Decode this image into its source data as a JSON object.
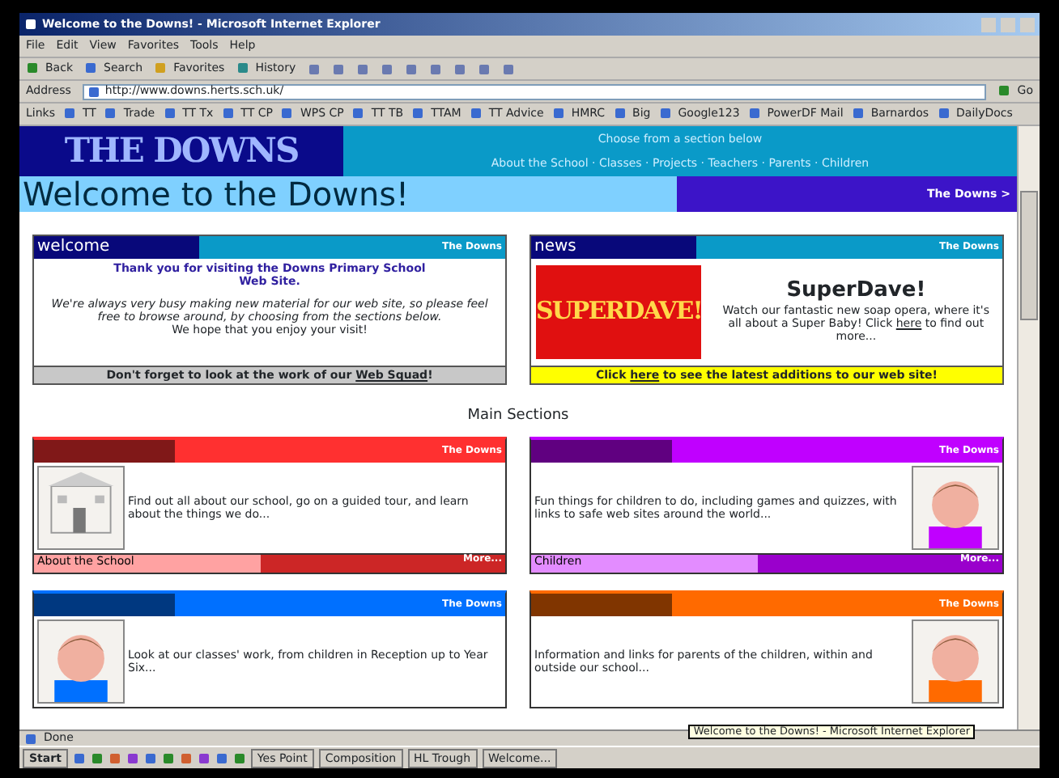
{
  "window": {
    "title": "Welcome to the Downs! - Microsoft Internet Explorer"
  },
  "menu": [
    "File",
    "Edit",
    "View",
    "Favorites",
    "Tools",
    "Help"
  ],
  "toolbar": [
    "Back",
    "Search",
    "Favorites",
    "History"
  ],
  "address": {
    "label": "Address",
    "value": "http://www.downs.herts.sch.uk/",
    "go": "Go"
  },
  "links": {
    "label": "Links",
    "items": [
      "TT",
      "Trade",
      "TT Tx",
      "TT CP",
      "WPS CP",
      "TT TB",
      "TTAM",
      "TT Advice",
      "HMRC",
      "Big",
      "Google123",
      "PowerDF Mail",
      "Barnardos",
      "DailyDocs"
    ]
  },
  "site": {
    "logo": "THE DOWNS",
    "prompt": "Choose from a section below",
    "nav": "About the School · Classes · Projects · Teachers · Parents · Children",
    "heading": "Welcome to the Downs!",
    "crumb": "The Downs >",
    "welcome": {
      "title": "welcome",
      "tag": "The Downs",
      "intro": "Thank you for visiting the Downs Primary School Web Site.",
      "body": "We're always very busy making new material for our web site, so please feel free to browse around, by choosing from the sections below.",
      "outro": "We hope that you enjoy your visit!",
      "footer": "Don't forget to look at the work of our ",
      "footer_link": "Web Squad",
      "footer_end": "!"
    },
    "news": {
      "title": "news",
      "tag": "The Downs",
      "banner": "SUPERDAVE!",
      "heading": "SuperDave!",
      "body": "Watch our fantastic new soap opera, where it's all about a Super Baby! ",
      "body_link": "here",
      "body_pre": "Click ",
      "body_end": " to find out more...",
      "footer_pre": "Click ",
      "footer_link": "here",
      "footer_end": " to see the latest additions to our web site!"
    },
    "sections_title": "Main Sections",
    "sections": [
      {
        "color": "#ff3030",
        "tag": "The Downs",
        "text": "Find out all about our school, go on a guided tour, and learn about the things we do...",
        "label": "About the School",
        "more": "More...",
        "kind": "image-left"
      },
      {
        "color": "#c000ff",
        "tag": "The Downs",
        "text": "Fun things for children to do, including games and quizzes, with links to safe web sites around the world...",
        "label": "Children",
        "more": "More...",
        "kind": "image-right"
      },
      {
        "color": "#0070ff",
        "tag": "The Downs",
        "text": "Look at our classes' work, from children in Reception up to Year Six...",
        "kind": "image-left"
      },
      {
        "color": "#ff6a00",
        "tag": "The Downs",
        "text": "Information and links for parents of the children, within and outside our school...",
        "kind": "image-right"
      }
    ]
  },
  "status": "Done",
  "taskbar": {
    "start": "Start",
    "tasks": [
      "Yes Point",
      "Composition",
      "HL Trough",
      "Welcome..."
    ],
    "tooltip": "Welcome to the Downs! - Microsoft Internet Explorer"
  }
}
